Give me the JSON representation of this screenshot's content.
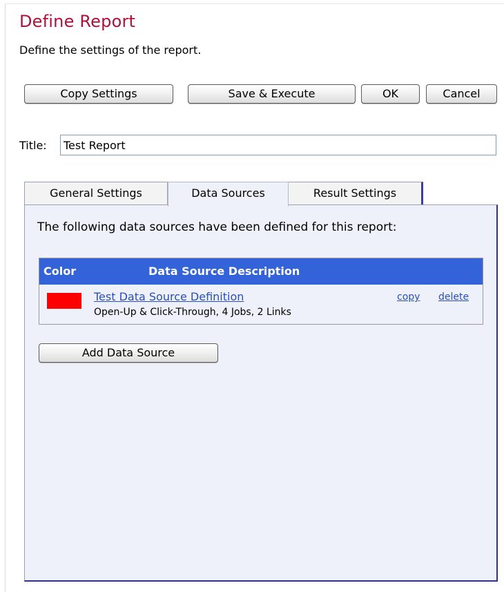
{
  "header": {
    "title": "Define Report",
    "subtitle": "Define the settings of the report."
  },
  "toolbar": {
    "copy_settings": "Copy Settings",
    "save_execute": "Save & Execute",
    "ok": "OK",
    "cancel": "Cancel"
  },
  "title_field": {
    "label": "Title:",
    "value": "Test Report"
  },
  "tabs": [
    {
      "label": "General Settings",
      "active": false
    },
    {
      "label": "Data Sources",
      "active": true
    },
    {
      "label": "Result Settings",
      "active": false
    }
  ],
  "data_sources": {
    "intro": "The following data sources have been defined for this report:",
    "columns": {
      "color": "Color",
      "description": "Data Source Description"
    },
    "rows": [
      {
        "color": "#ff0000",
        "name": "Test Data Source Definition",
        "detail": "Open-Up & Click-Through, 4 Jobs, 2 Links",
        "copy_label": "copy",
        "delete_label": "delete"
      }
    ],
    "add_button": "Add Data Source"
  },
  "colors": {
    "title": "#b0103a",
    "header_bg": "#3462d9",
    "panel_bg": "#eef1f9",
    "link": "#2a4fbd"
  }
}
